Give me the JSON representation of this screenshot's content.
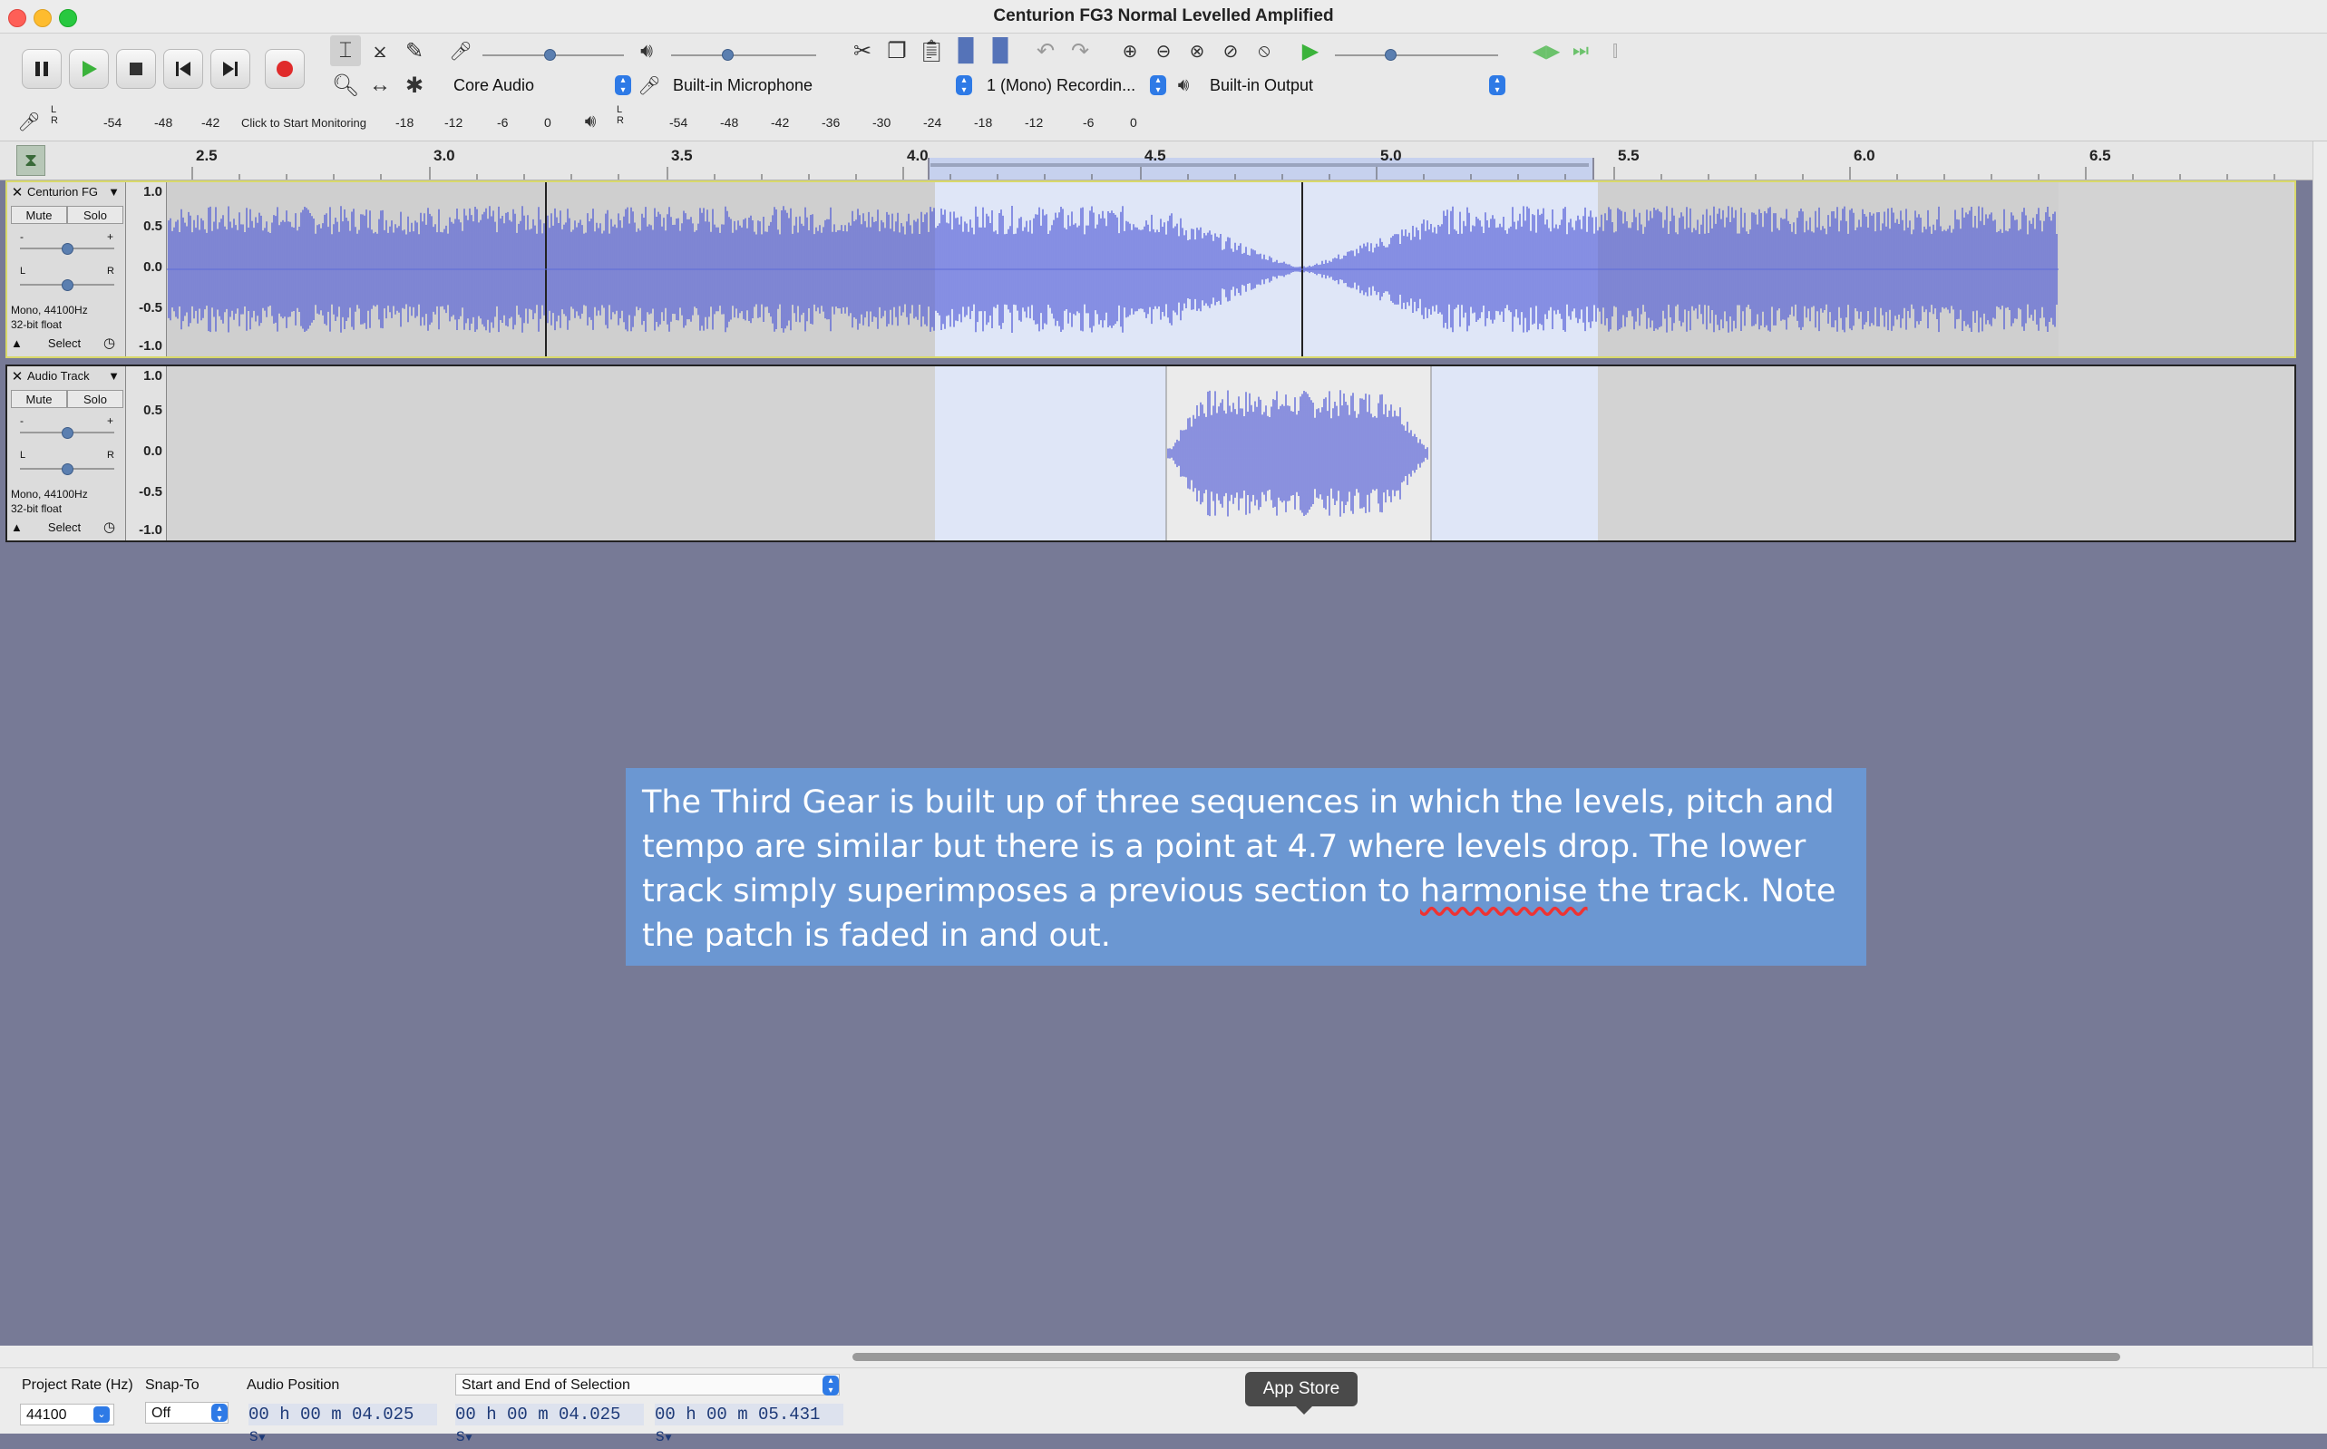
{
  "window": {
    "title": "Centurion FG3 Normal Levelled Amplified"
  },
  "colors": {
    "background": "#777a96",
    "waveform": "#4a55d6",
    "selection": "#dfe6f7",
    "annotation": "#6b97d2"
  },
  "transport": {
    "buttons": [
      "pause",
      "play",
      "stop",
      "skip-to-start",
      "skip-to-end",
      "record"
    ]
  },
  "devices": {
    "host": "Core Audio",
    "input_device": "Built-in Microphone",
    "channels": "1 (Mono) Recordin...",
    "output_device": "Built-in Output"
  },
  "meters": {
    "record_ticks": [
      "-54",
      "-48",
      "-42",
      "-18",
      "-12",
      "-6",
      "0"
    ],
    "record_hint": "Click to Start Monitoring",
    "play_ticks": [
      "-54",
      "-48",
      "-42",
      "-36",
      "-30",
      "-24",
      "-18",
      "-12",
      "-6",
      "0"
    ],
    "lr_l": "L",
    "lr_r": "R"
  },
  "ruler": {
    "labels": [
      "2.5",
      "3.0",
      "3.5",
      "4.0",
      "4.5",
      "5.0",
      "5.5",
      "6.0",
      "6.5"
    ]
  },
  "tracks": [
    {
      "name": "Centurion FG",
      "mute": "Mute",
      "solo": "Solo",
      "gain_minus": "-",
      "gain_plus": "+",
      "pan_l": "L",
      "pan_r": "R",
      "info1": "Mono, 44100Hz",
      "info2": "32-bit float",
      "select": "Select",
      "scale": [
        "1.0",
        "0.5",
        "0.0",
        "-0.5",
        "-1.0"
      ]
    },
    {
      "name": "Audio Track",
      "mute": "Mute",
      "solo": "Solo",
      "gain_minus": "-",
      "gain_plus": "+",
      "pan_l": "L",
      "pan_r": "R",
      "info1": "Mono, 44100Hz",
      "info2": "32-bit float",
      "select": "Select",
      "scale": [
        "1.0",
        "0.5",
        "0.0",
        "-0.5",
        "-1.0"
      ]
    }
  ],
  "annotation": {
    "before": "The Third Gear is built up of three sequences in which the levels, pitch and tempo are similar but there is a point at 4.7 where levels drop. The lower track simply superimposes a previous section to ",
    "marked": "harmonise",
    "after": " the track. Note the patch is faded in and out."
  },
  "status": {
    "project_rate_label": "Project Rate (Hz)",
    "project_rate_value": "44100",
    "snap_label": "Snap-To",
    "snap_value": "Off",
    "audio_pos_label": "Audio Position",
    "audio_pos_value": "00 h 00 m 04.025 s",
    "selection_mode": "Start and End of Selection",
    "sel_start": "00 h 00 m 04.025 s",
    "sel_end": "00 h 00 m 05.431 s"
  },
  "dock_tooltip": "App Store"
}
